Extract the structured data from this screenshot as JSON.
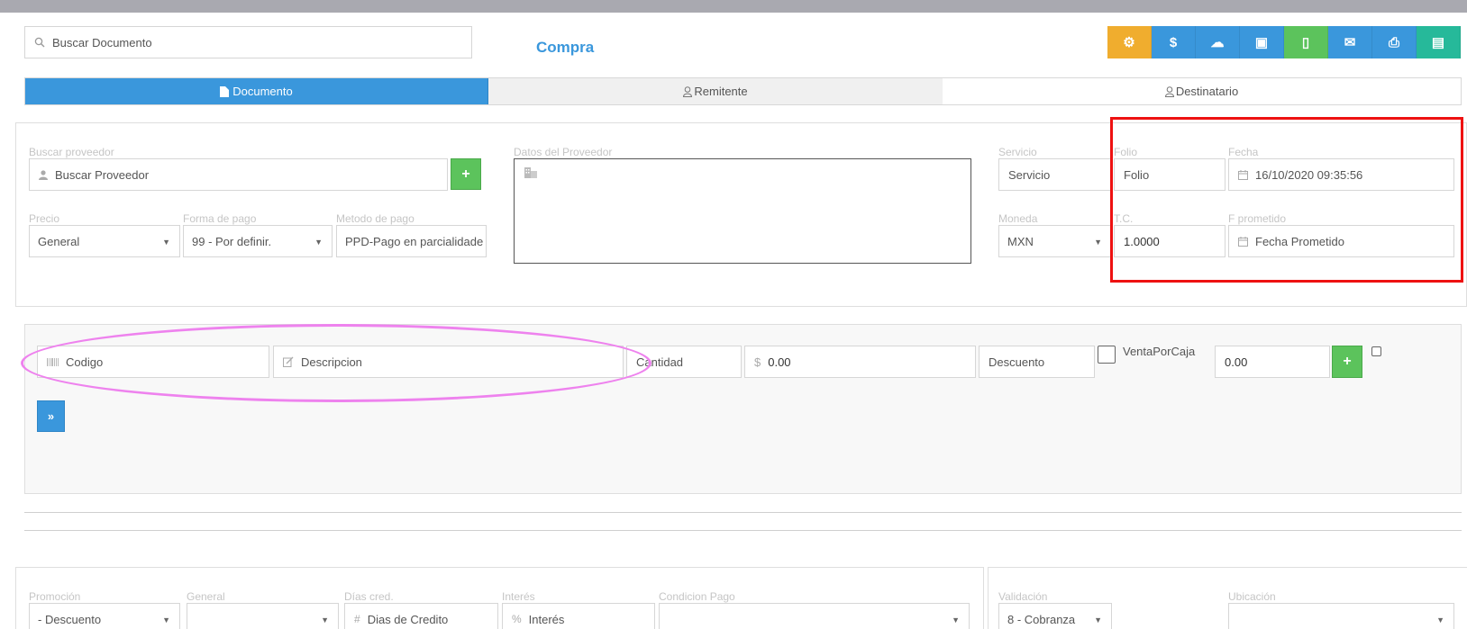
{
  "header": {
    "search_placeholder": "Buscar Documento",
    "title": "Compra"
  },
  "toolbar": {
    "buttons": [
      {
        "name": "settings-button",
        "icon": "gears-icon",
        "color": "#f0ad2e",
        "glyph": "⚙"
      },
      {
        "name": "payment-button",
        "icon": "dollar-icon",
        "color": "#3a97dc",
        "glyph": "$"
      },
      {
        "name": "cloud-upload-button",
        "icon": "cloud-upload-icon",
        "color": "#3a97dc",
        "glyph": "☁"
      },
      {
        "name": "money-button",
        "icon": "money-icon",
        "color": "#3a97dc",
        "glyph": "▣"
      },
      {
        "name": "new-document-button",
        "icon": "file-icon",
        "color": "#5cc35c",
        "glyph": "▯"
      },
      {
        "name": "email-button",
        "icon": "envelope-icon",
        "color": "#3a97dc",
        "glyph": "✉"
      },
      {
        "name": "print-button",
        "icon": "print-icon",
        "color": "#3a97dc",
        "glyph": "⎙"
      },
      {
        "name": "save-button",
        "icon": "save-icon",
        "color": "#26b99a",
        "glyph": "▤"
      }
    ]
  },
  "tabs": [
    {
      "label": "Documento",
      "icon": "file-icon"
    },
    {
      "label": "Remitente",
      "icon": "user-icon"
    },
    {
      "label": "Destinatario",
      "icon": "user-icon"
    }
  ],
  "proveedor": {
    "search_label": "Buscar proveedor",
    "search_placeholder": "Buscar Proveedor",
    "datos_label": "Datos del Proveedor",
    "precio_label": "Precio",
    "precio_value": "General",
    "forma_pago_label": "Forma de pago",
    "forma_pago_value": "99 - Por definir.",
    "metodo_pago_label": "Metodo de pago",
    "metodo_pago_value": "PPD-Pago en parcialidade"
  },
  "documento": {
    "servicio_label": "Servicio",
    "servicio_value": "Servicio",
    "folio_label": "Folio",
    "folio_placeholder": "Folio",
    "fecha_label": "Fecha",
    "fecha_value": "16/10/2020 09:35:56",
    "moneda_label": "Moneda",
    "moneda_value": "MXN",
    "tc_label": "T.C.",
    "tc_value": "1.0000",
    "fprometido_label": "F prometido",
    "fprometido_placeholder": "Fecha Prometido"
  },
  "items": {
    "codigo_placeholder": "Codigo",
    "descripcion_placeholder": "Descripcion",
    "cantidad_placeholder": "Cantidad",
    "precio_value": "0.00",
    "descuento_placeholder": "Descuento",
    "venta_por_caja_label": "VentaPorCaja",
    "total_value": "0.00"
  },
  "footer": {
    "promocion_label": "Promoción",
    "promocion_value": "- Descuento",
    "general_label": "General",
    "dias_cred_label": "Días cred.",
    "dias_cred_placeholder": "Dias de Credito",
    "interes_label": "Interés",
    "interes_placeholder": "Interés",
    "condicion_pago_label": "Condicion Pago",
    "validacion_label": "Validación",
    "validacion_value": "8 - Cobranza",
    "ubicacion_label": "Ubicación"
  },
  "annotations": {
    "highlight_rect_color": "#ee1111",
    "highlight_ellipse_color": "#ee82ee"
  }
}
